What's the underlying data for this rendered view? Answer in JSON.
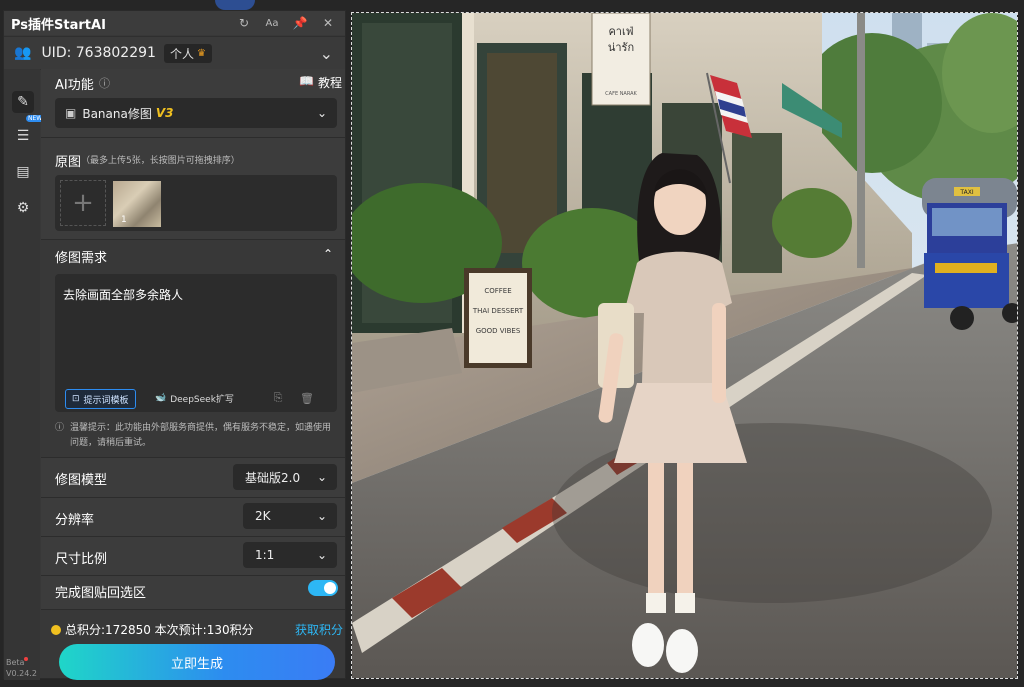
{
  "app_title": "Ps插件StartAI",
  "user": {
    "uid_label": "UID:  763802291",
    "badge": "个人"
  },
  "sidebar": {
    "new_tag": "NEW",
    "version_beta": "Beta",
    "version": "V0.24.2"
  },
  "ai_function": {
    "label": "AI功能",
    "tutorial": "教程",
    "selected": "Banana修图",
    "selected_badge": "V3"
  },
  "original": {
    "label": "原图",
    "hint": "（最多上传5张，长按图片可拖拽排序）",
    "thumb_index": "1"
  },
  "requirement": {
    "label": "修图需求",
    "text": "去除画面全部多余路人",
    "template_btn": "提示词模板",
    "deepseek_btn": "DeepSeek扩写"
  },
  "notice": "温馨提示：此功能由外部服务商提供，偶有服务不稳定，如遇使用问题，请稍后重试。",
  "model": {
    "label": "修图模型",
    "value": "基础版2.0"
  },
  "resolution": {
    "label": "分辨率",
    "value": "2K"
  },
  "ratio": {
    "label": "尺寸比例",
    "value": "1:1"
  },
  "paste_back": {
    "label": "完成图贴回选区",
    "enabled": true
  },
  "points": {
    "text": "总积分:172850  本次预计:130积分",
    "get": "获取积分"
  },
  "generate": {
    "label": "立即生成"
  },
  "canvas_image": {
    "sign_lines": [
      "COFFEE",
      "THAI DESSERT",
      "GOOD VIBES"
    ],
    "hanging_sign": [
      "คาเฟ่",
      "น่ารัก",
      "CAFE NARAK"
    ],
    "tuktuk_sign": "TAXI"
  },
  "colors": {
    "accent": "#2db7f5",
    "gold": "#f0c020",
    "panel": "#383838"
  }
}
